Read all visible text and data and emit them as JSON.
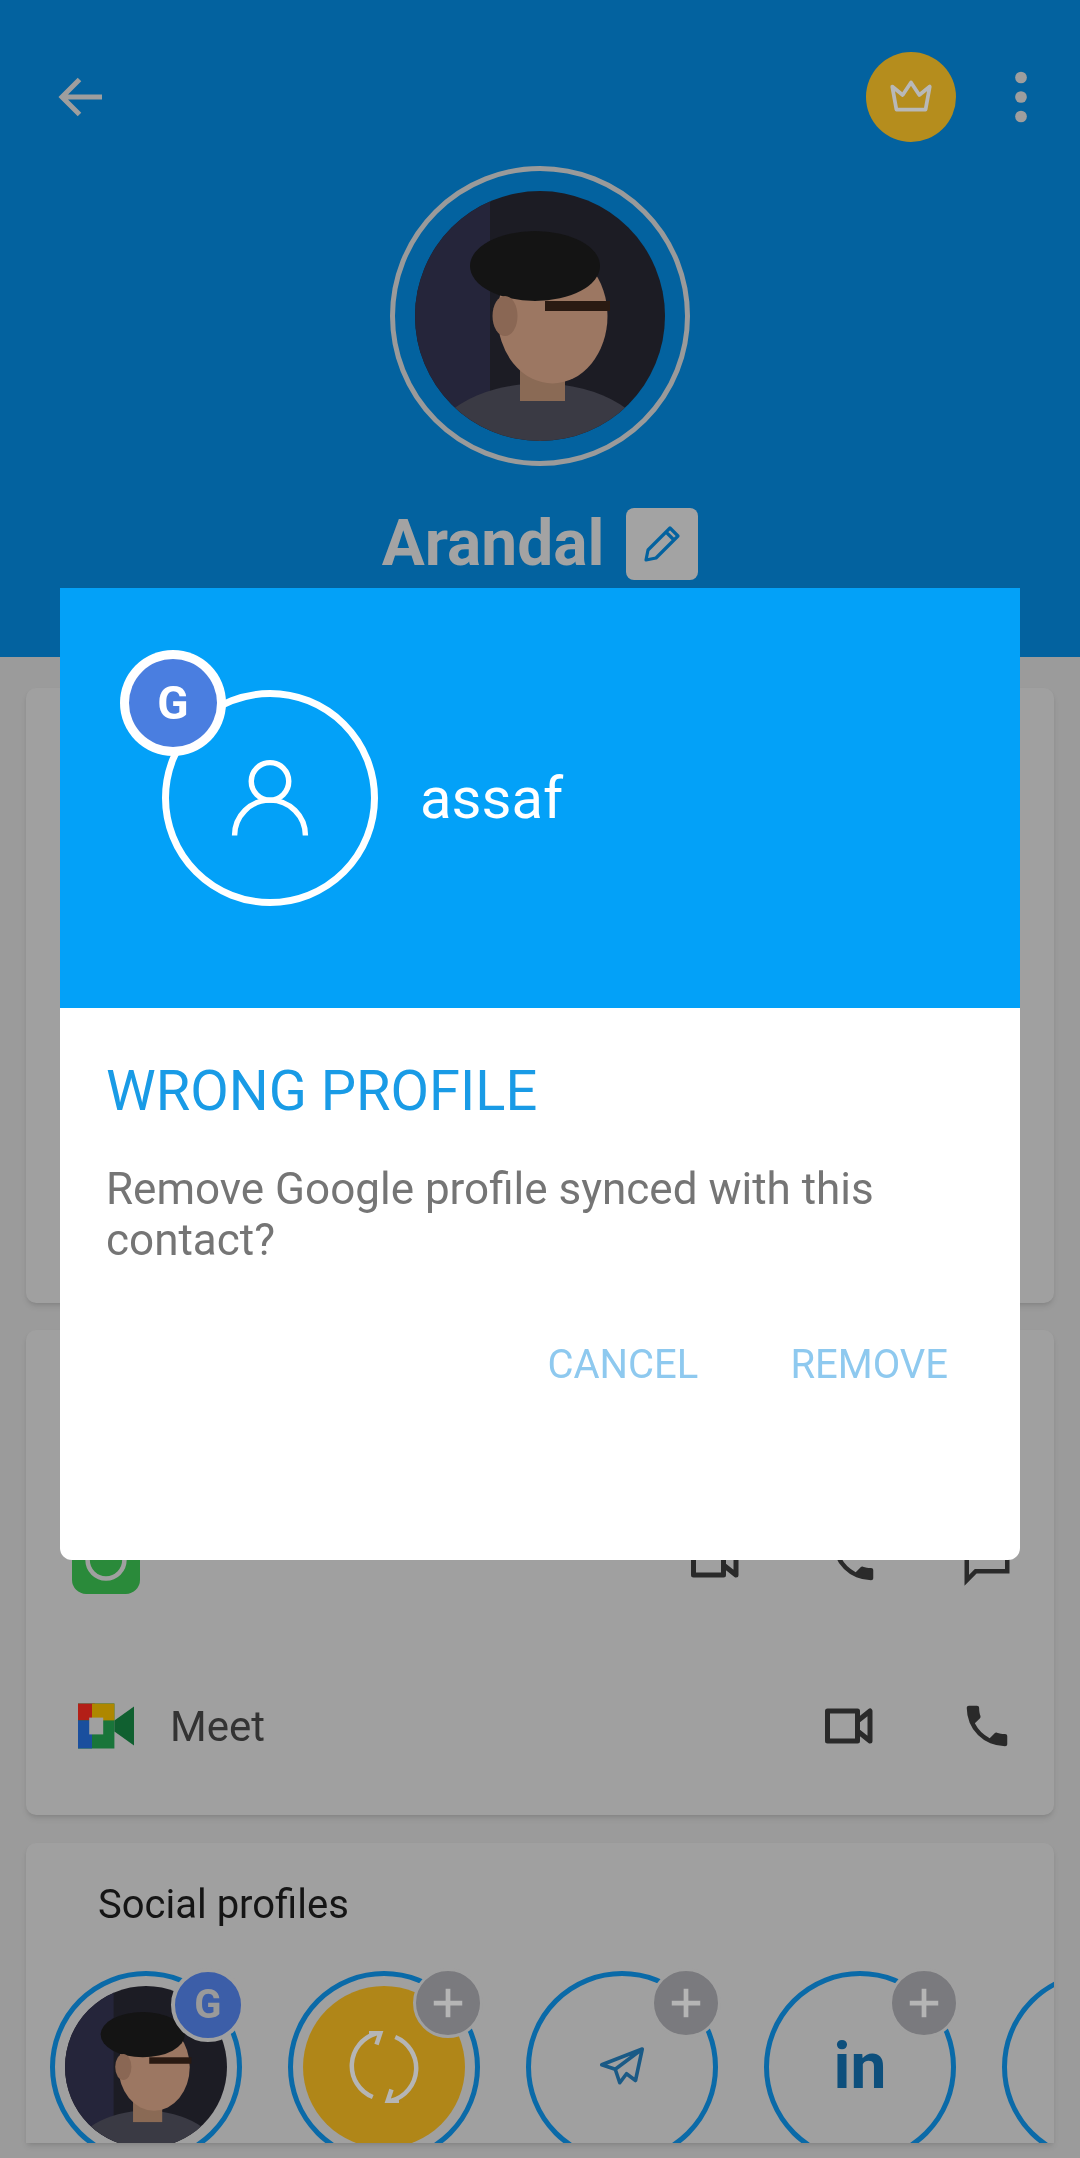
{
  "header": {
    "title": "Arandal"
  },
  "dialog": {
    "account_name": "assaf",
    "badge": "G",
    "title": "WRONG PROFILE",
    "message": "Remove Google profile synced with this contact?",
    "buttons": [
      "CANCEL",
      "REMOVE"
    ]
  },
  "apps": [
    {
      "kind": "whatsapp"
    },
    {
      "name": "Meet",
      "kind": "meet"
    }
  ],
  "social": {
    "title": "Social profiles",
    "profiles": [
      {
        "badge": "G"
      },
      {
        "kind": "sync",
        "addable": true
      },
      {
        "kind": "telegram",
        "addable": true
      },
      {
        "kind": "linkedin",
        "label": "in",
        "addable": true
      },
      {
        "kind": "more"
      }
    ]
  }
}
